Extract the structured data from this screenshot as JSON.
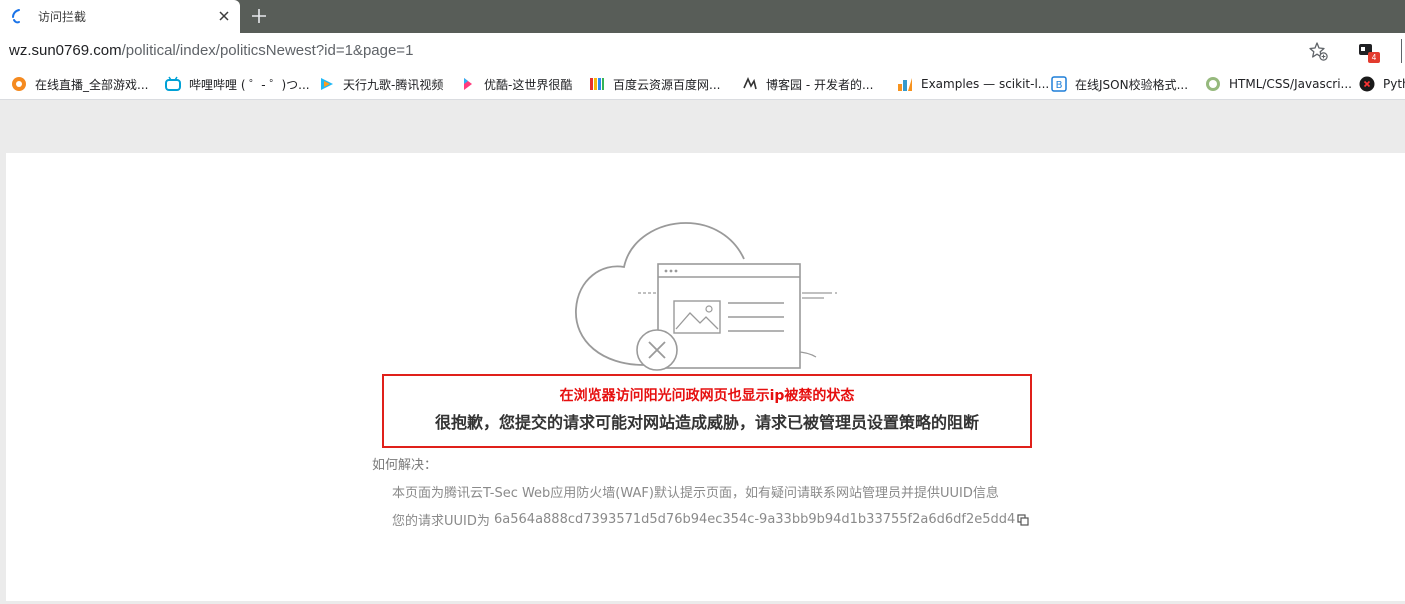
{
  "browser": {
    "tab": {
      "title": "访问拦截"
    },
    "address_bar": {
      "host": "wz.sun0769.com",
      "path": "/political/index/politicsNewest?id=1&page=1"
    },
    "extension_badge": "4",
    "bookmarks": [
      {
        "label": "在线直播_全部游戏...",
        "icon": "douyu-icon"
      },
      {
        "label": "哔哩哔哩 ( ゜- ゜)つ...",
        "icon": "bilibili-icon"
      },
      {
        "label": "天行九歌-腾讯视频",
        "icon": "tencent-video-icon"
      },
      {
        "label": "优酷-这世界很酷",
        "icon": "youku-icon"
      },
      {
        "label": "百度云资源百度网...",
        "icon": "baidu-cloud-icon"
      },
      {
        "label": "博客园 - 开发者的...",
        "icon": "cnblogs-icon"
      },
      {
        "label": "Examples — scikit-l...",
        "icon": "chart-icon"
      },
      {
        "label": "在线JSON校验格式...",
        "icon": "json-icon"
      },
      {
        "label": "HTML/CSS/Javascri...",
        "icon": "runoob-icon"
      },
      {
        "label": "Pyth",
        "icon": "python-icon"
      }
    ]
  },
  "page": {
    "annotation": "在浏览器访问阳光问政网页也显示ip被禁的状态",
    "message": "很抱歉，您提交的请求可能对网站造成威胁，请求已被管理员设置策略的阻断",
    "howto_label": "如何解决：",
    "detail_line1": "本页面为腾讯云T-Sec Web应用防火墙(WAF)默认提示页面，如有疑问请联系网站管理员并提供UUID信息",
    "uuid_prefix": "您的请求UUID为 ",
    "uuid": "6a564a888cd7393571d5d76b94ec354c-9a33bb9b94d1b33755f2a6d6df2e5dd4"
  },
  "colors": {
    "tabstrip": "#585d58",
    "annotation_red": "#e60f0f",
    "box_border": "#e0201a",
    "illustration_gray": "#9a9a9a"
  }
}
